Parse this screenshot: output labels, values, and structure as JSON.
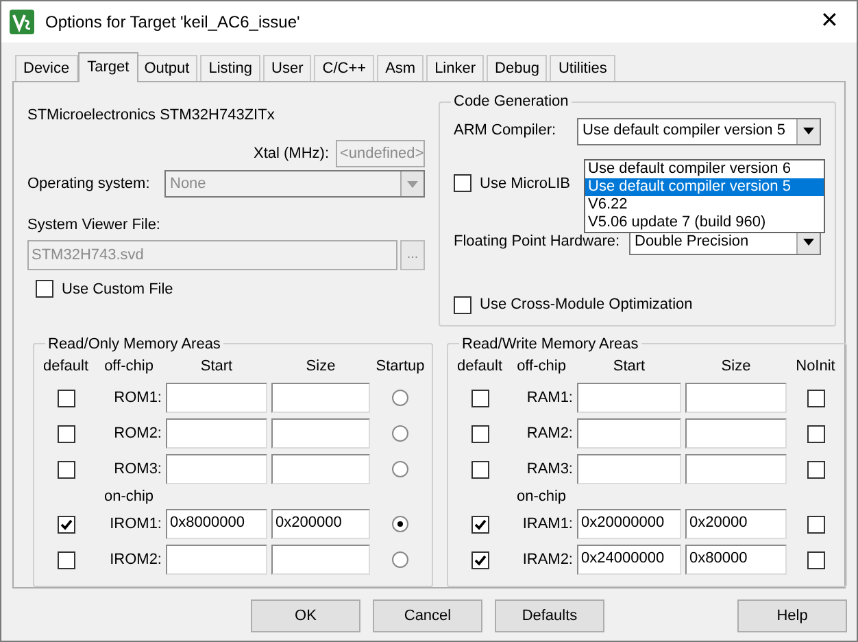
{
  "window": {
    "title": "Options for Target 'keil_AC6_issue'",
    "close": "✕"
  },
  "tabs": [
    {
      "label": "Device",
      "selected": false
    },
    {
      "label": "Target",
      "selected": true
    },
    {
      "label": "Output",
      "selected": false
    },
    {
      "label": "Listing",
      "selected": false
    },
    {
      "label": "User",
      "selected": false
    },
    {
      "label": "C/C++",
      "selected": false
    },
    {
      "label": "Asm",
      "selected": false
    },
    {
      "label": "Linker",
      "selected": false
    },
    {
      "label": "Debug",
      "selected": false
    },
    {
      "label": "Utilities",
      "selected": false
    }
  ],
  "device": "STMicroelectronics STM32H743ZITx",
  "xtal": {
    "label": "Xtal (MHz):",
    "value": "<undefined>",
    "disabled": true
  },
  "operating_system": {
    "label": "Operating system:",
    "value": "None",
    "disabled": true
  },
  "system_viewer_file": {
    "label": "System Viewer File:",
    "value": "STM32H743.svd",
    "button": "...",
    "disabled": true
  },
  "use_custom_file": {
    "label": "Use Custom File",
    "checked": false
  },
  "code_generation": {
    "title": "Code Generation",
    "arm_compiler": {
      "label": "ARM Compiler:",
      "value": "Use default compiler version 5",
      "expanded": true,
      "options": [
        {
          "label": "Use default compiler version 6",
          "selected": false
        },
        {
          "label": "Use default compiler version 5",
          "selected": true
        },
        {
          "label": "V6.22",
          "selected": false
        },
        {
          "label": "V5.06 update 7 (build 960)",
          "selected": false
        }
      ]
    },
    "use_microlib": {
      "label": "Use MicroLIB",
      "checked": false
    },
    "floating_point_hardware": {
      "label": "Floating Point Hardware:",
      "value": "Double Precision"
    },
    "cross_module_optimization": {
      "label": "Use Cross-Module Optimization",
      "checked": false
    }
  },
  "rom_areas": {
    "title": "Read/Only Memory Areas",
    "columns": [
      "default",
      "off-chip",
      "Start",
      "Size",
      "Startup"
    ],
    "on_chip_label": "on-chip",
    "off_chip": [
      {
        "name": "ROM1:",
        "default": false,
        "startup": false
      },
      {
        "name": "ROM2:",
        "default": false,
        "startup": false
      },
      {
        "name": "ROM3:",
        "default": false,
        "startup": false
      }
    ],
    "on_chip": [
      {
        "name": "IROM1:",
        "default": true,
        "start": "0x8000000",
        "size": "0x200000",
        "startup": true
      },
      {
        "name": "IROM2:",
        "default": false,
        "startup": false
      }
    ]
  },
  "ram_areas": {
    "title": "Read/Write Memory Areas",
    "columns": [
      "default",
      "off-chip",
      "Start",
      "Size",
      "NoInit"
    ],
    "on_chip_label": "on-chip",
    "off_chip": [
      {
        "name": "RAM1:",
        "default": false,
        "noinit": false
      },
      {
        "name": "RAM2:",
        "default": false,
        "noinit": false
      },
      {
        "name": "RAM3:",
        "default": false,
        "noinit": false
      }
    ],
    "on_chip": [
      {
        "name": "IRAM1:",
        "default": true,
        "start": "0x20000000",
        "size": "0x20000",
        "noinit": false
      },
      {
        "name": "IRAM2:",
        "default": true,
        "start": "0x24000000",
        "size": "0x80000",
        "noinit": false
      }
    ]
  },
  "buttons": [
    {
      "label": "OK",
      "kind": "main"
    },
    {
      "label": "Cancel",
      "kind": "main"
    },
    {
      "label": "Defaults",
      "kind": "main"
    },
    {
      "label": "Help",
      "kind": "side"
    }
  ]
}
